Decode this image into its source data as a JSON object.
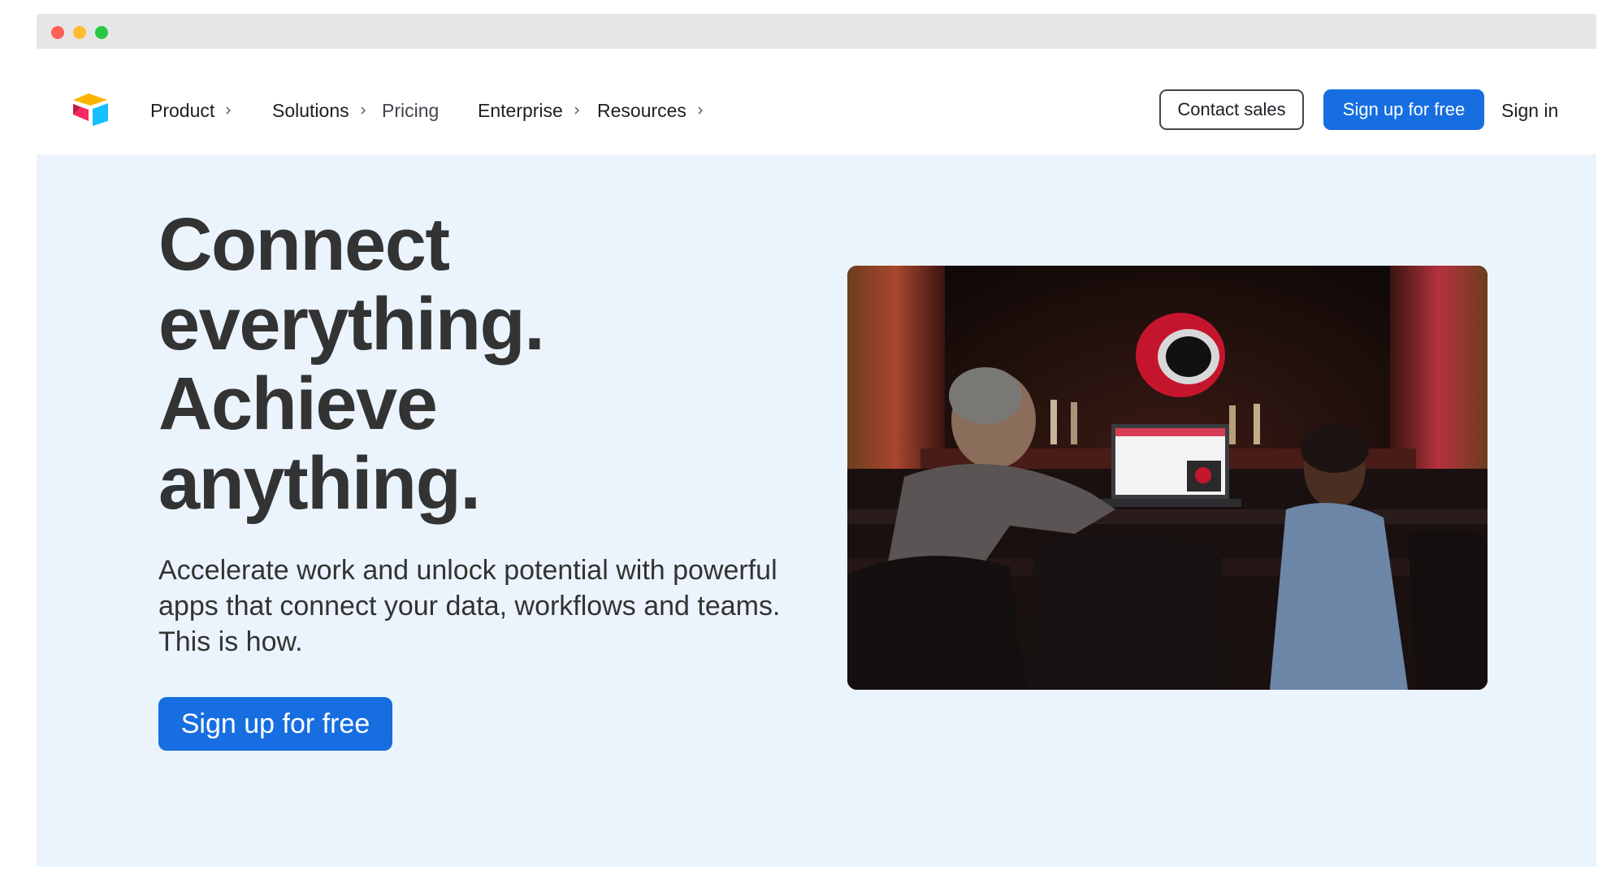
{
  "nav": {
    "logo_icon": "airtable-logo-icon",
    "items": [
      {
        "label": "Product",
        "has_chevron": true
      },
      {
        "label": "Solutions",
        "has_chevron": true
      },
      {
        "label": "Pricing",
        "has_chevron": false
      },
      {
        "label": "Enterprise",
        "has_chevron": true
      },
      {
        "label": "Resources",
        "has_chevron": true
      }
    ],
    "contact_sales": "Contact sales",
    "signup": "Sign up for free",
    "signin": "Sign in"
  },
  "hero": {
    "headline_lines": [
      "Connect",
      "everything.",
      "Achieve",
      "anything."
    ],
    "subtext": "Accelerate work and unlock potential with powerful apps that connect your data, workflows and teams. This is how.",
    "cta": "Sign up for free",
    "image_icon": "theater-laptop-photo"
  },
  "colors": {
    "accent": "#166ee1",
    "hero_bg": "#ebf4fd",
    "text": "#333333"
  }
}
